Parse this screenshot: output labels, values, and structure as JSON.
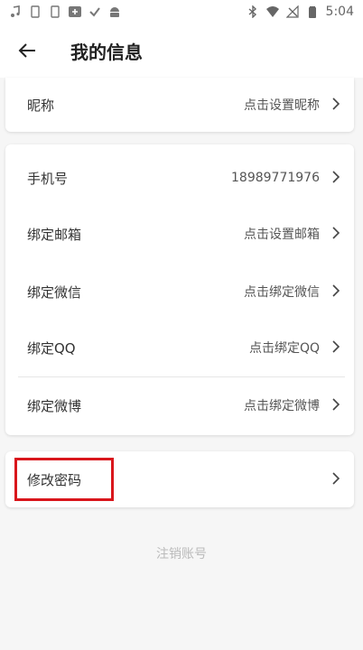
{
  "status_bar": {
    "time": "5:04",
    "icons_left": [
      "music-note-icon",
      "phone-outline-icon",
      "phone-outline-icon",
      "media-icon",
      "check-icon",
      "android-icon"
    ],
    "icons_right": [
      "bluetooth-icon",
      "wifi-icon",
      "no-signal-icon",
      "battery-icon"
    ]
  },
  "header": {
    "title": "我的信息"
  },
  "profile": {
    "nickname": {
      "label": "昵称",
      "value": "点击设置昵称"
    }
  },
  "accounts": [
    {
      "label": "手机号",
      "value": "18989771976"
    },
    {
      "label": "绑定邮箱",
      "value": "点击设置邮箱"
    },
    {
      "label": "绑定微信",
      "value": "点击绑定微信"
    },
    {
      "label": "绑定QQ",
      "value": "点击绑定QQ"
    },
    {
      "label": "绑定微博",
      "value": "点击绑定微博"
    }
  ],
  "security": {
    "change_password": {
      "label": "修改密码"
    }
  },
  "footer": {
    "deregister_label": "注销账号"
  },
  "colors": {
    "highlight": "#d9161c",
    "background": "#f6f6f6"
  }
}
